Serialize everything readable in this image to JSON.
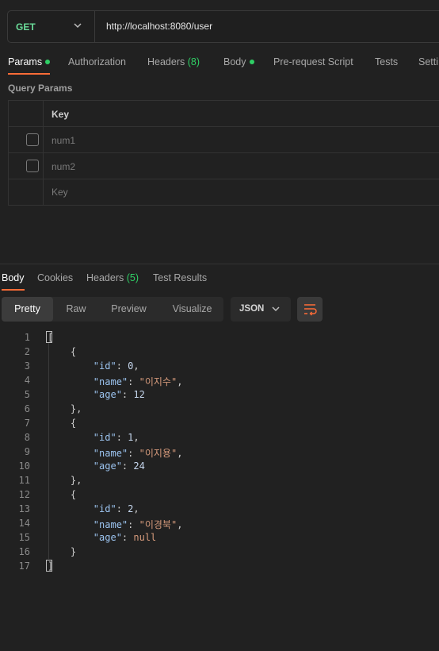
{
  "request": {
    "method": "GET",
    "url": "http://localhost:8080/user",
    "tabs": [
      {
        "label": "Params",
        "active": true,
        "dot": true
      },
      {
        "label": "Authorization"
      },
      {
        "label": "Headers",
        "count": "(8)"
      },
      {
        "label": "Body",
        "dot": true
      },
      {
        "label": "Pre-request Script"
      },
      {
        "label": "Tests"
      },
      {
        "label": "Setti"
      }
    ]
  },
  "query_params": {
    "title": "Query Params",
    "key_header": "Key",
    "rows": [
      "num1",
      "num2"
    ],
    "placeholder": "Key"
  },
  "response": {
    "tabs": [
      {
        "label": "Body",
        "active": true
      },
      {
        "label": "Cookies"
      },
      {
        "label": "Headers",
        "count": "(5)"
      },
      {
        "label": "Test Results"
      }
    ],
    "views": [
      "Pretty",
      "Raw",
      "Preview",
      "Visualize"
    ],
    "format": "JSON",
    "line_numbers": [
      "1",
      "2",
      "3",
      "4",
      "5",
      "6",
      "7",
      "8",
      "9",
      "10",
      "11",
      "12",
      "13",
      "14",
      "15",
      "16",
      "17"
    ],
    "items": [
      {
        "id": "0",
        "name": "\"이지수\"",
        "age": "12",
        "age_null": false
      },
      {
        "id": "1",
        "name": "\"이지용\"",
        "age": "24",
        "age_null": false
      },
      {
        "id": "2",
        "name": "\"이경북\"",
        "age": "null",
        "age_null": true
      }
    ],
    "keys": {
      "id": "\"id\"",
      "name": "\"name\"",
      "age": "\"age\""
    },
    "punct": {
      "open_arr": "[",
      "close_arr": "]",
      "open_obj": "{",
      "close_obj": "}",
      "close_obj_comma": "},",
      "colon": ": ",
      "comma": ","
    }
  },
  "colors": {
    "accent": "#ff6c37",
    "get": "#6bdd9a",
    "dot": "#2fcf65"
  }
}
